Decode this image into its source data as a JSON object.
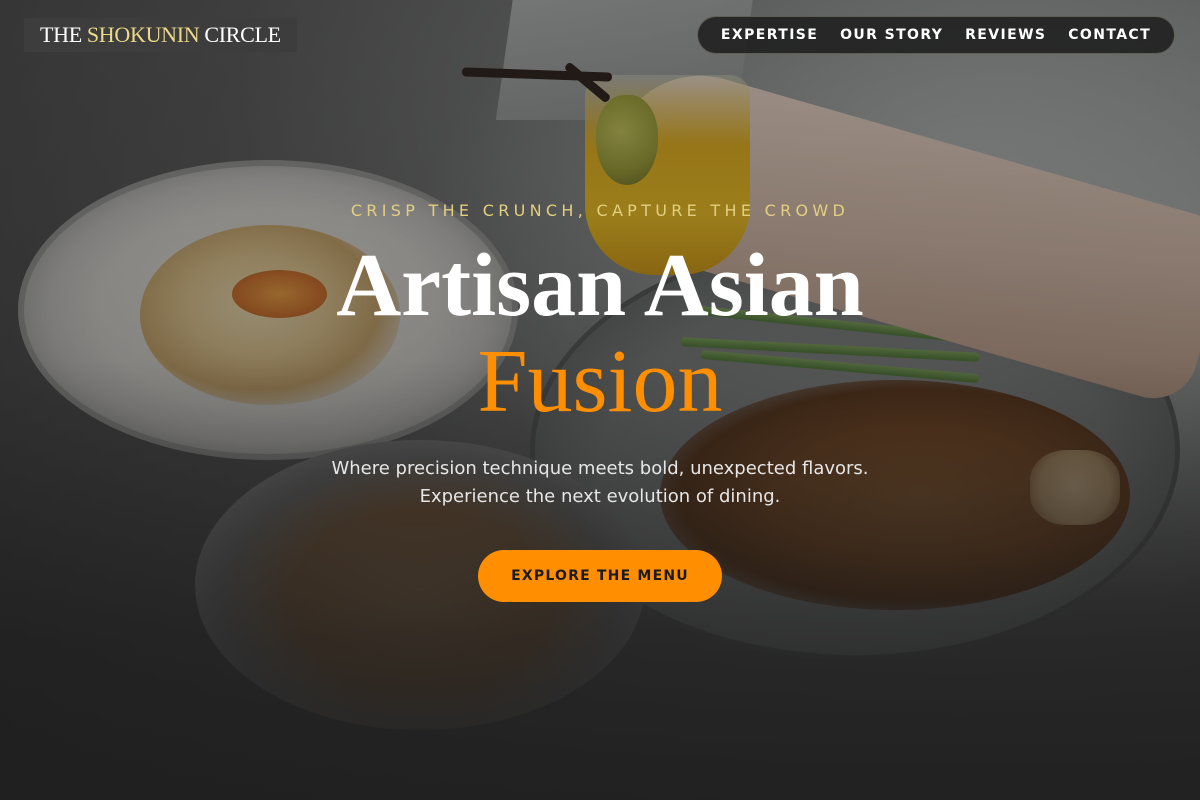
{
  "brand": {
    "logo_part1": "THE",
    "logo_part2": "SHOKUNIN",
    "logo_part3": "CIRCLE",
    "accent_color": "#ff8f00",
    "gold_color": "#e3cf80"
  },
  "nav": {
    "items": [
      {
        "label": "EXPERTISE"
      },
      {
        "label": "OUR STORY"
      },
      {
        "label": "REVIEWS"
      },
      {
        "label": "CONTACT"
      }
    ]
  },
  "hero": {
    "eyebrow": "CRISP THE CRUNCH, CAPTURE THE CROWD",
    "title_line1": "Artisan Asian",
    "title_line2": "Fusion",
    "subtitle_line1": "Where precision technique meets bold, unexpected flavors.",
    "subtitle_line2": "Experience the next evolution of dining.",
    "cta_label": "EXPLORE THE MENU"
  }
}
